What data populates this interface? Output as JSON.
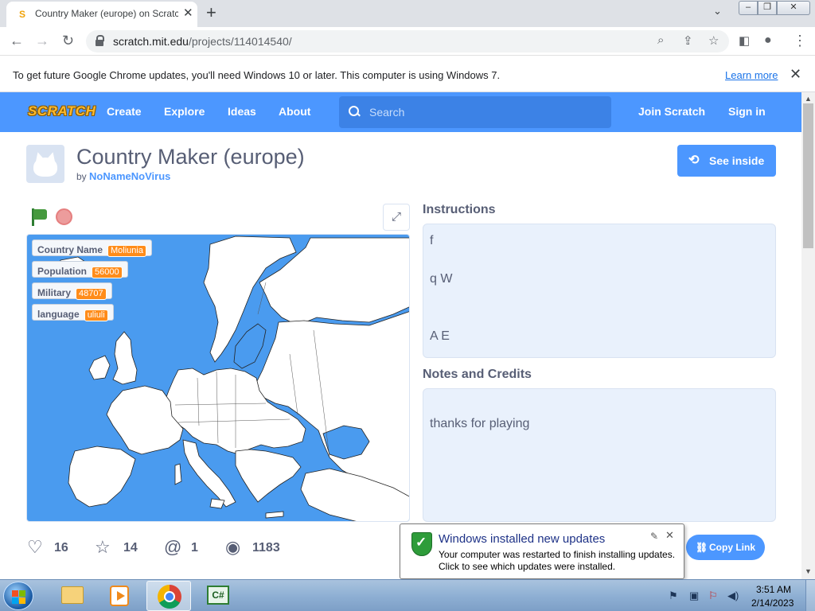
{
  "browser": {
    "tab_title": "Country Maker (europe) on Scratch",
    "tab_favicon": "scratch-favicon",
    "url_host": "scratch.mit.edu",
    "url_path": "/projects/114014540/"
  },
  "infobar": {
    "message": "To get future Google Chrome updates, you'll need Windows 10 or later. This computer is using Windows 7.",
    "link": "Learn more"
  },
  "nav": {
    "logo": "SCRATCH",
    "create": "Create",
    "explore": "Explore",
    "ideas": "Ideas",
    "about": "About",
    "search_placeholder": "Search",
    "join": "Join Scratch",
    "signin": "Sign in"
  },
  "project": {
    "title": "Country Maker (europe)",
    "by": "by",
    "author": "NoNameNoVirus",
    "see_inside": "See inside"
  },
  "monitors": [
    {
      "label": "Country Name",
      "value": "Moliunia"
    },
    {
      "label": "Population",
      "value": "56000"
    },
    {
      "label": "Military",
      "value": "48707"
    },
    {
      "label": "language",
      "value": "uliuli"
    }
  ],
  "instructions": {
    "title": "Instructions",
    "lines": [
      "f",
      "q W",
      "A E"
    ]
  },
  "notes": {
    "title": "Notes and Credits",
    "text": "thanks for playing"
  },
  "stats": {
    "loves": "16",
    "favorites": "14",
    "remixes": "1",
    "views": "1183",
    "copy_link": "Copy Link"
  },
  "balloon": {
    "title": "Windows installed new updates",
    "line1": "Your computer was restarted to finish installing updates.",
    "line2": "Click to see which updates were installed."
  },
  "taskbar": {
    "time": "3:51 AM",
    "date": "2/14/2023",
    "csharp": "C#"
  },
  "colors": {
    "scratch_blue": "#4c97ff",
    "stage_sea": "#4a9bef",
    "monitor_value": "#ff8c1a",
    "text": "#575e75"
  }
}
